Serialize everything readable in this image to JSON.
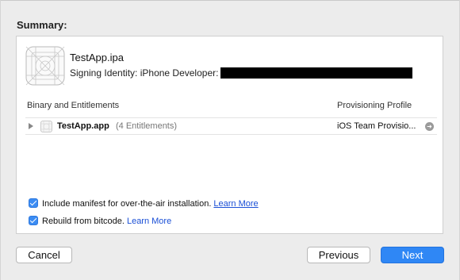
{
  "summary": {
    "title": "Summary:"
  },
  "app": {
    "name": "TestApp.ipa",
    "signing_label": "Signing Identity: iPhone Developer:"
  },
  "table": {
    "columns": [
      "Binary and Entitlements",
      "Provisioning Profile"
    ],
    "rows": [
      {
        "name": "TestApp.app",
        "entitlements": "(4 Entitlements)",
        "profile": "iOS Team Provisio..."
      }
    ]
  },
  "options": {
    "manifest": {
      "label": "Include manifest for over-the-air installation.",
      "link": "Learn More",
      "checked": true
    },
    "bitcode": {
      "label": "Rebuild from bitcode.",
      "link": "Learn More",
      "checked": true
    }
  },
  "buttons": {
    "cancel": "Cancel",
    "previous": "Previous",
    "next": "Next"
  },
  "icons": {
    "app_icon": "app-placeholder-icon",
    "row_icon": "app-bundle-icon",
    "disclosure": "disclosure-triangle-icon",
    "goto": "arrow-circle-right-icon",
    "checkbox": "checkmark-icon"
  },
  "colors": {
    "accent": "#2f87f5",
    "link": "#1a4fd6",
    "background": "#ececec"
  }
}
